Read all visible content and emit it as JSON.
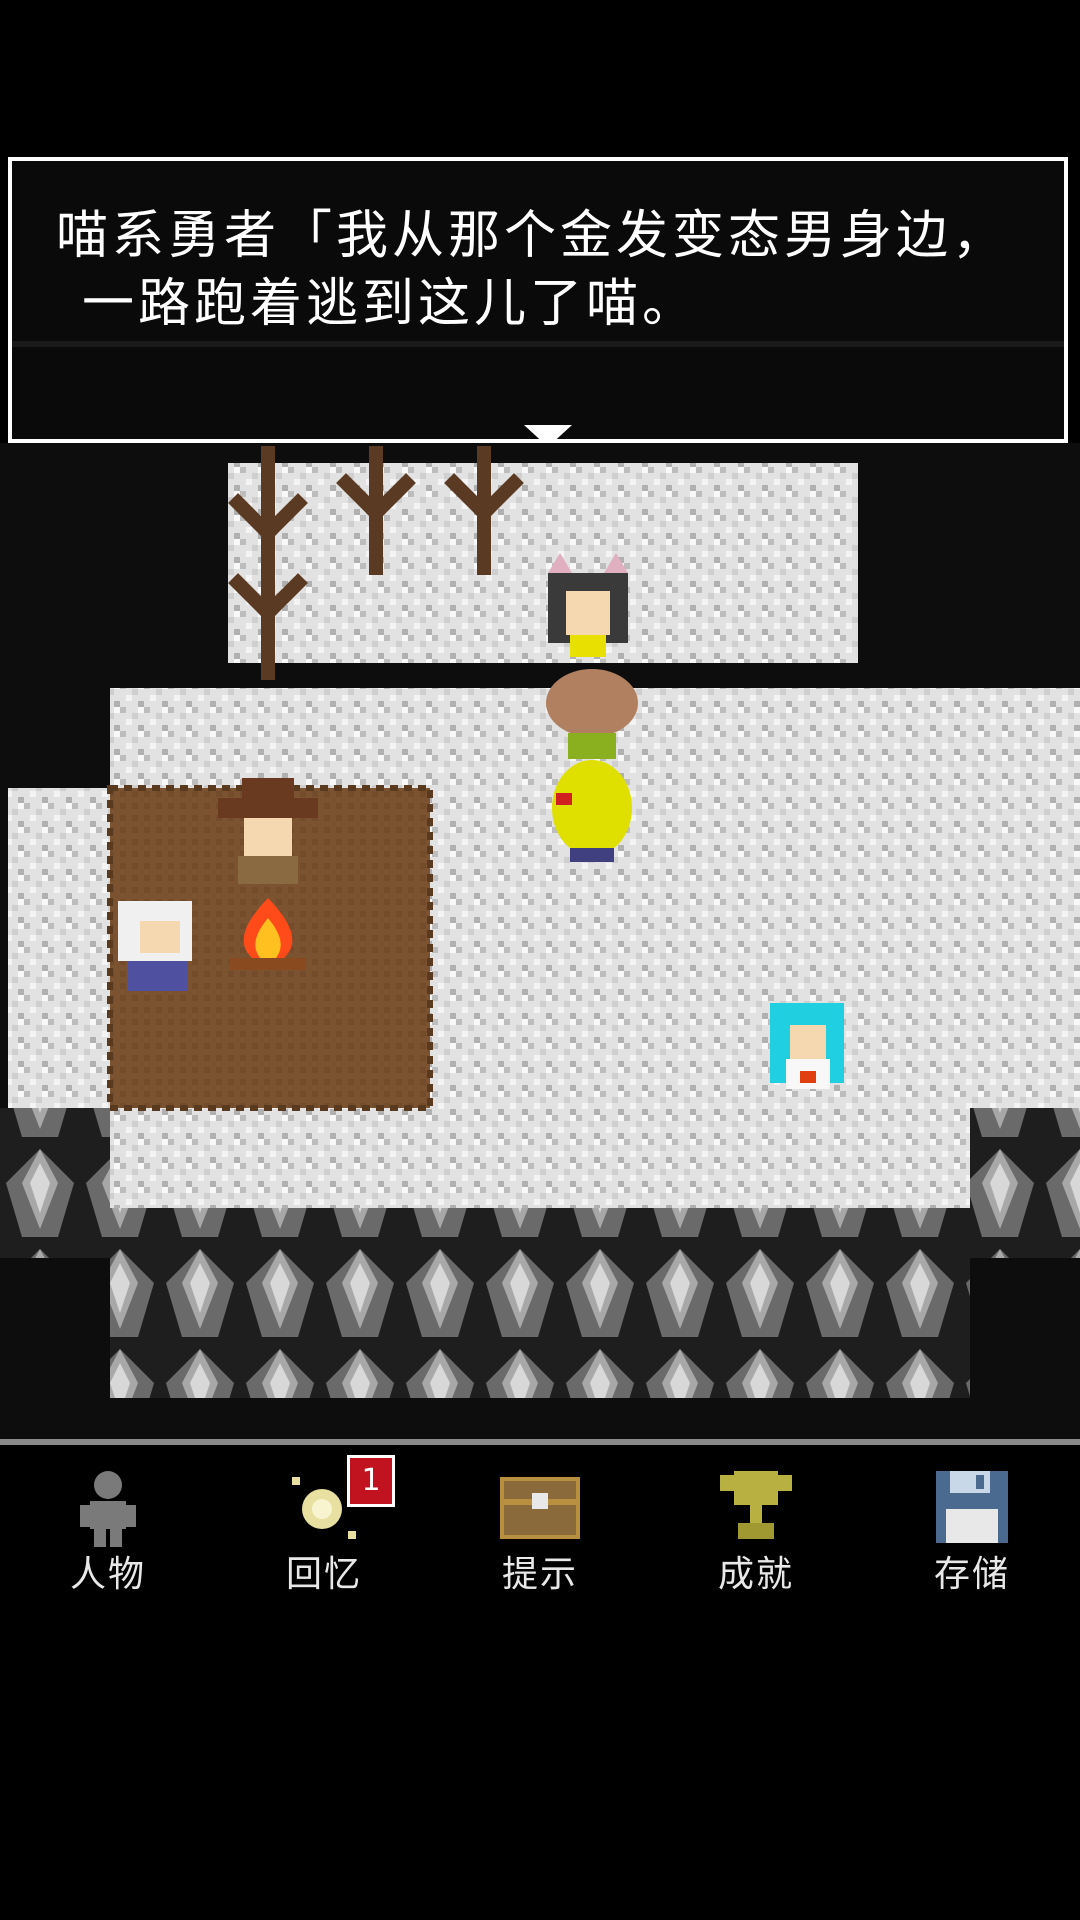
{
  "dialog": {
    "line1": "喵系勇者「我从那个金发变态男身边，",
    "line2": "一路跑着逃到这儿了喵。"
  },
  "menu": {
    "items": [
      {
        "label": "人物",
        "icon": "character-icon"
      },
      {
        "label": "回忆",
        "icon": "memory-icon",
        "badge": "1"
      },
      {
        "label": "提示",
        "icon": "treasure-chest-icon"
      },
      {
        "label": "成就",
        "icon": "trophy-icon"
      },
      {
        "label": "存储",
        "icon": "floppy-disk-icon"
      }
    ]
  },
  "colors": {
    "snow": "#e4e4e4",
    "rock": "#5a5a5a",
    "rug": "#7a5230",
    "fire": "#ff5a1f",
    "badge": "#c1121f",
    "menu_label": "#e8e8e8"
  }
}
